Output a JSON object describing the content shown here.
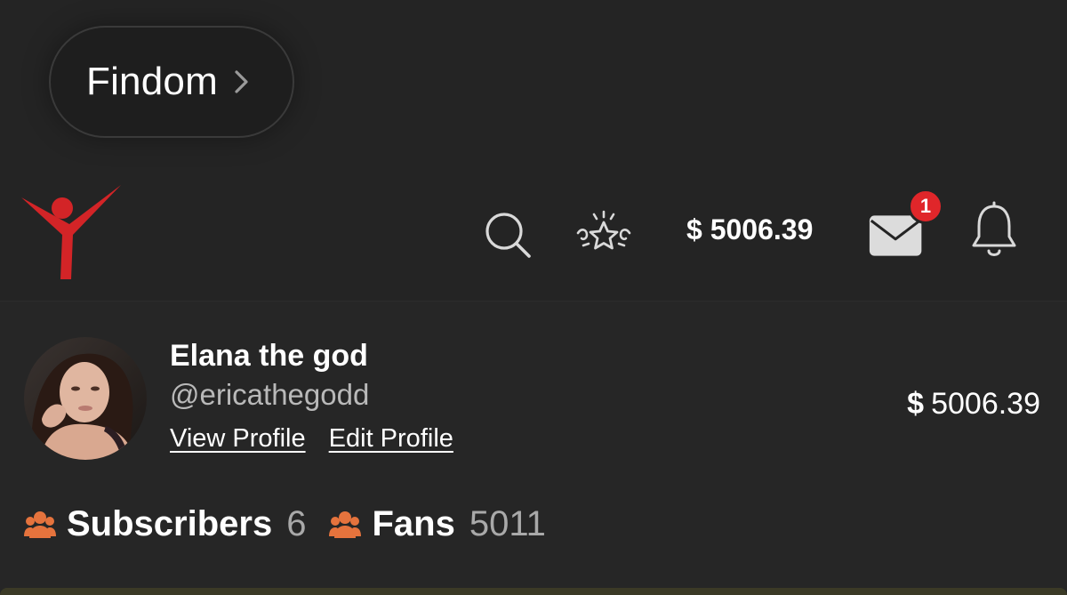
{
  "category_pill": {
    "label": "Findom",
    "chevron_icon": "chevron-right-icon"
  },
  "navbar": {
    "logo_icon": "brand-logo-figure",
    "search_icon": "search-icon",
    "star_icon": "sparkle-star-icon",
    "balance": "$ 5006.39",
    "messages_icon": "envelope-icon",
    "messages_badge": "1",
    "notifications_icon": "bell-icon"
  },
  "profile": {
    "name": "Elana the god",
    "handle": "@ericathegodd",
    "view_profile": "View Profile",
    "edit_profile": "Edit Profile",
    "balance_currency": "$",
    "balance_amount": "5006.39"
  },
  "stats": {
    "subscribers_label": "Subscribers",
    "subscribers_value": "6",
    "fans_label": "Fans",
    "fans_value": "5011",
    "group_icon": "people-group-icon"
  },
  "colors": {
    "background": "#252525",
    "brand_red": "#d32427",
    "badge_red": "#e0262a",
    "stat_icon_orange": "#e5733d",
    "muted_text": "#b9b9b9"
  }
}
